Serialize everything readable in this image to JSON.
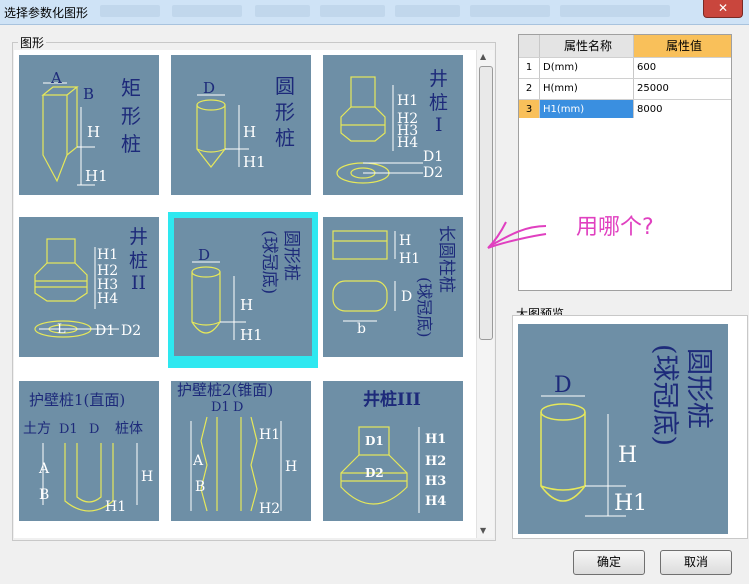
{
  "window": {
    "title": "选择参数化图形",
    "close": "✕"
  },
  "gallery": {
    "label": "图形",
    "tiles": [
      {
        "name": "矩形桩",
        "labels": {
          "a": "A",
          "b": "B",
          "h": "H",
          "h1": "H1",
          "t1": "矩",
          "t2": "形",
          "t3": "桩"
        }
      },
      {
        "name": "圆形桩",
        "labels": {
          "d": "D",
          "h": "H",
          "h1": "H1",
          "t1": "圆",
          "t2": "形",
          "t3": "桩"
        }
      },
      {
        "name": "井桩I",
        "labels": {
          "h1": "H1",
          "h2": "H2",
          "h3": "H3",
          "h4": "H4",
          "d1": "D1",
          "d2": "D2",
          "t1": "井",
          "t2": "桩",
          "t3": "I"
        }
      },
      {
        "name": "井桩II",
        "labels": {
          "h1": "H1",
          "h2": "H2",
          "h3": "H3",
          "h4": "H4",
          "l": "L",
          "d1": "D1",
          "d2": "D2",
          "t1": "井",
          "t2": "桩",
          "t3": "II"
        }
      },
      {
        "name": "圆形桩(球冠底)",
        "labels": {
          "d": "D",
          "h": "H",
          "h1": "H1",
          "t1": "圆形桩",
          "t2": "(球冠底)"
        }
      },
      {
        "name": "长圆柱桩(球冠底)",
        "labels": {
          "h": "H",
          "h1": "H1",
          "d": "D",
          "b": "b",
          "t1": "长圆柱桩",
          "t2": "(球冠底)"
        }
      },
      {
        "name": "护壁桩1(直面)",
        "labels": {
          "title": "护壁桩1(直面)",
          "tf": "土方",
          "d1": "D1",
          "d": "D",
          "zt": "桩体",
          "a": "A",
          "b": "B",
          "h": "H",
          "h1": "H1"
        }
      },
      {
        "name": "护壁桩2(锥面)",
        "labels": {
          "title": "护壁桩2(锥面)",
          "d1": "D1",
          "d": "D",
          "a": "A",
          "b": "B",
          "h": "H",
          "h1": "H1",
          "h2": "H2"
        }
      },
      {
        "name": "井桩III",
        "labels": {
          "title": "井桩III",
          "d1": "D1",
          "d2": "D2",
          "h1": "H1",
          "h2": "H2",
          "h3": "H3",
          "h4": "H4"
        }
      }
    ]
  },
  "properties": {
    "headers": {
      "name": "属性名称",
      "value": "属性值"
    },
    "rows": [
      {
        "idx": "1",
        "name": "D(mm)",
        "value": "600"
      },
      {
        "idx": "2",
        "name": "H(mm)",
        "value": "25000"
      },
      {
        "idx": "3",
        "name": "H1(mm)",
        "value": "8000"
      }
    ]
  },
  "preview": {
    "label": "大图预览",
    "d": "D",
    "h": "H",
    "h1": "H1",
    "t1": "圆形桩",
    "t2": "(球冠底)"
  },
  "annotation": {
    "text": "用哪个?"
  },
  "buttons": {
    "ok": "确定",
    "cancel": "取消"
  },
  "colors": {
    "tile_bg": "#6e8fa6",
    "selected": "#2ee8f0",
    "header_value": "#f9c05a",
    "row_highlight": "#3a8fe0",
    "annotation": "#e040c0"
  }
}
